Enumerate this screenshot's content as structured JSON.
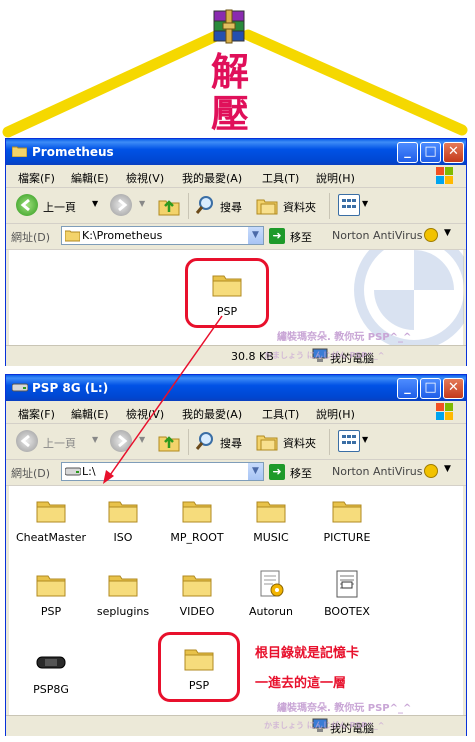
{
  "decoration": {
    "chars": [
      "解",
      "壓"
    ]
  },
  "window1": {
    "title": "Prometheus",
    "menus": [
      "檔案(F)",
      "編輯(E)",
      "檢視(V)",
      "我的最愛(A)",
      "工具(T)",
      "說明(H)"
    ],
    "toolbar": {
      "back": "上一頁",
      "search": "搜尋",
      "folders": "資料夾"
    },
    "address_label": "網址(D)",
    "address_value": "K:\\Prometheus",
    "go_label": "移至",
    "norton": "Norton AntiVirus",
    "files": [
      {
        "name": "PSP",
        "icon": "folder-icon"
      }
    ],
    "status_size": "30.8 KB",
    "status_location": "我的電腦",
    "watermark_line1": "繡裝瑪奈朵. 教你玩 PSP^_^",
    "watermark_line2": "かましょう にんじがん PSP^_^"
  },
  "window2": {
    "title": "PSP 8G (L:)",
    "menus": [
      "檔案(F)",
      "編輯(E)",
      "檢視(V)",
      "我的最愛(A)",
      "工具(T)",
      "說明(H)"
    ],
    "toolbar": {
      "back": "上一頁",
      "search": "搜尋",
      "folders": "資料夾"
    },
    "address_label": "網址(D)",
    "address_value": "L:\\",
    "go_label": "移至",
    "norton": "Norton AntiVirus",
    "files": [
      {
        "name": "CheatMaster",
        "icon": "folder-icon"
      },
      {
        "name": "ISO",
        "icon": "folder-icon"
      },
      {
        "name": "MP_ROOT",
        "icon": "folder-icon"
      },
      {
        "name": "MUSIC",
        "icon": "folder-icon"
      },
      {
        "name": "PICTURE",
        "icon": "folder-icon"
      },
      {
        "name": "PSP",
        "icon": "folder-icon"
      },
      {
        "name": "seplugins",
        "icon": "folder-icon"
      },
      {
        "name": "VIDEO",
        "icon": "folder-icon"
      },
      {
        "name": "Autorun",
        "icon": "autorun-icon"
      },
      {
        "name": "BOOTEX",
        "icon": "text-file-icon"
      },
      {
        "name": "PSP8G",
        "icon": "psp-device-icon"
      },
      {
        "name": "PSP",
        "icon": "folder-icon"
      }
    ],
    "note_line1": "根目錄就是記憶卡",
    "note_line2": "一進去的這一層",
    "status_location": "我的電腦",
    "watermark_line1": "繡裝瑪奈朵. 教你玩 PSP^_^",
    "watermark_line2": "かましょう にんじがん PSP^_^"
  },
  "colors": {
    "accent_red": "#e8102c",
    "title_blue": "#0052e6",
    "roof_yellow": "#f5d800",
    "char_pink": "#e0105a"
  }
}
